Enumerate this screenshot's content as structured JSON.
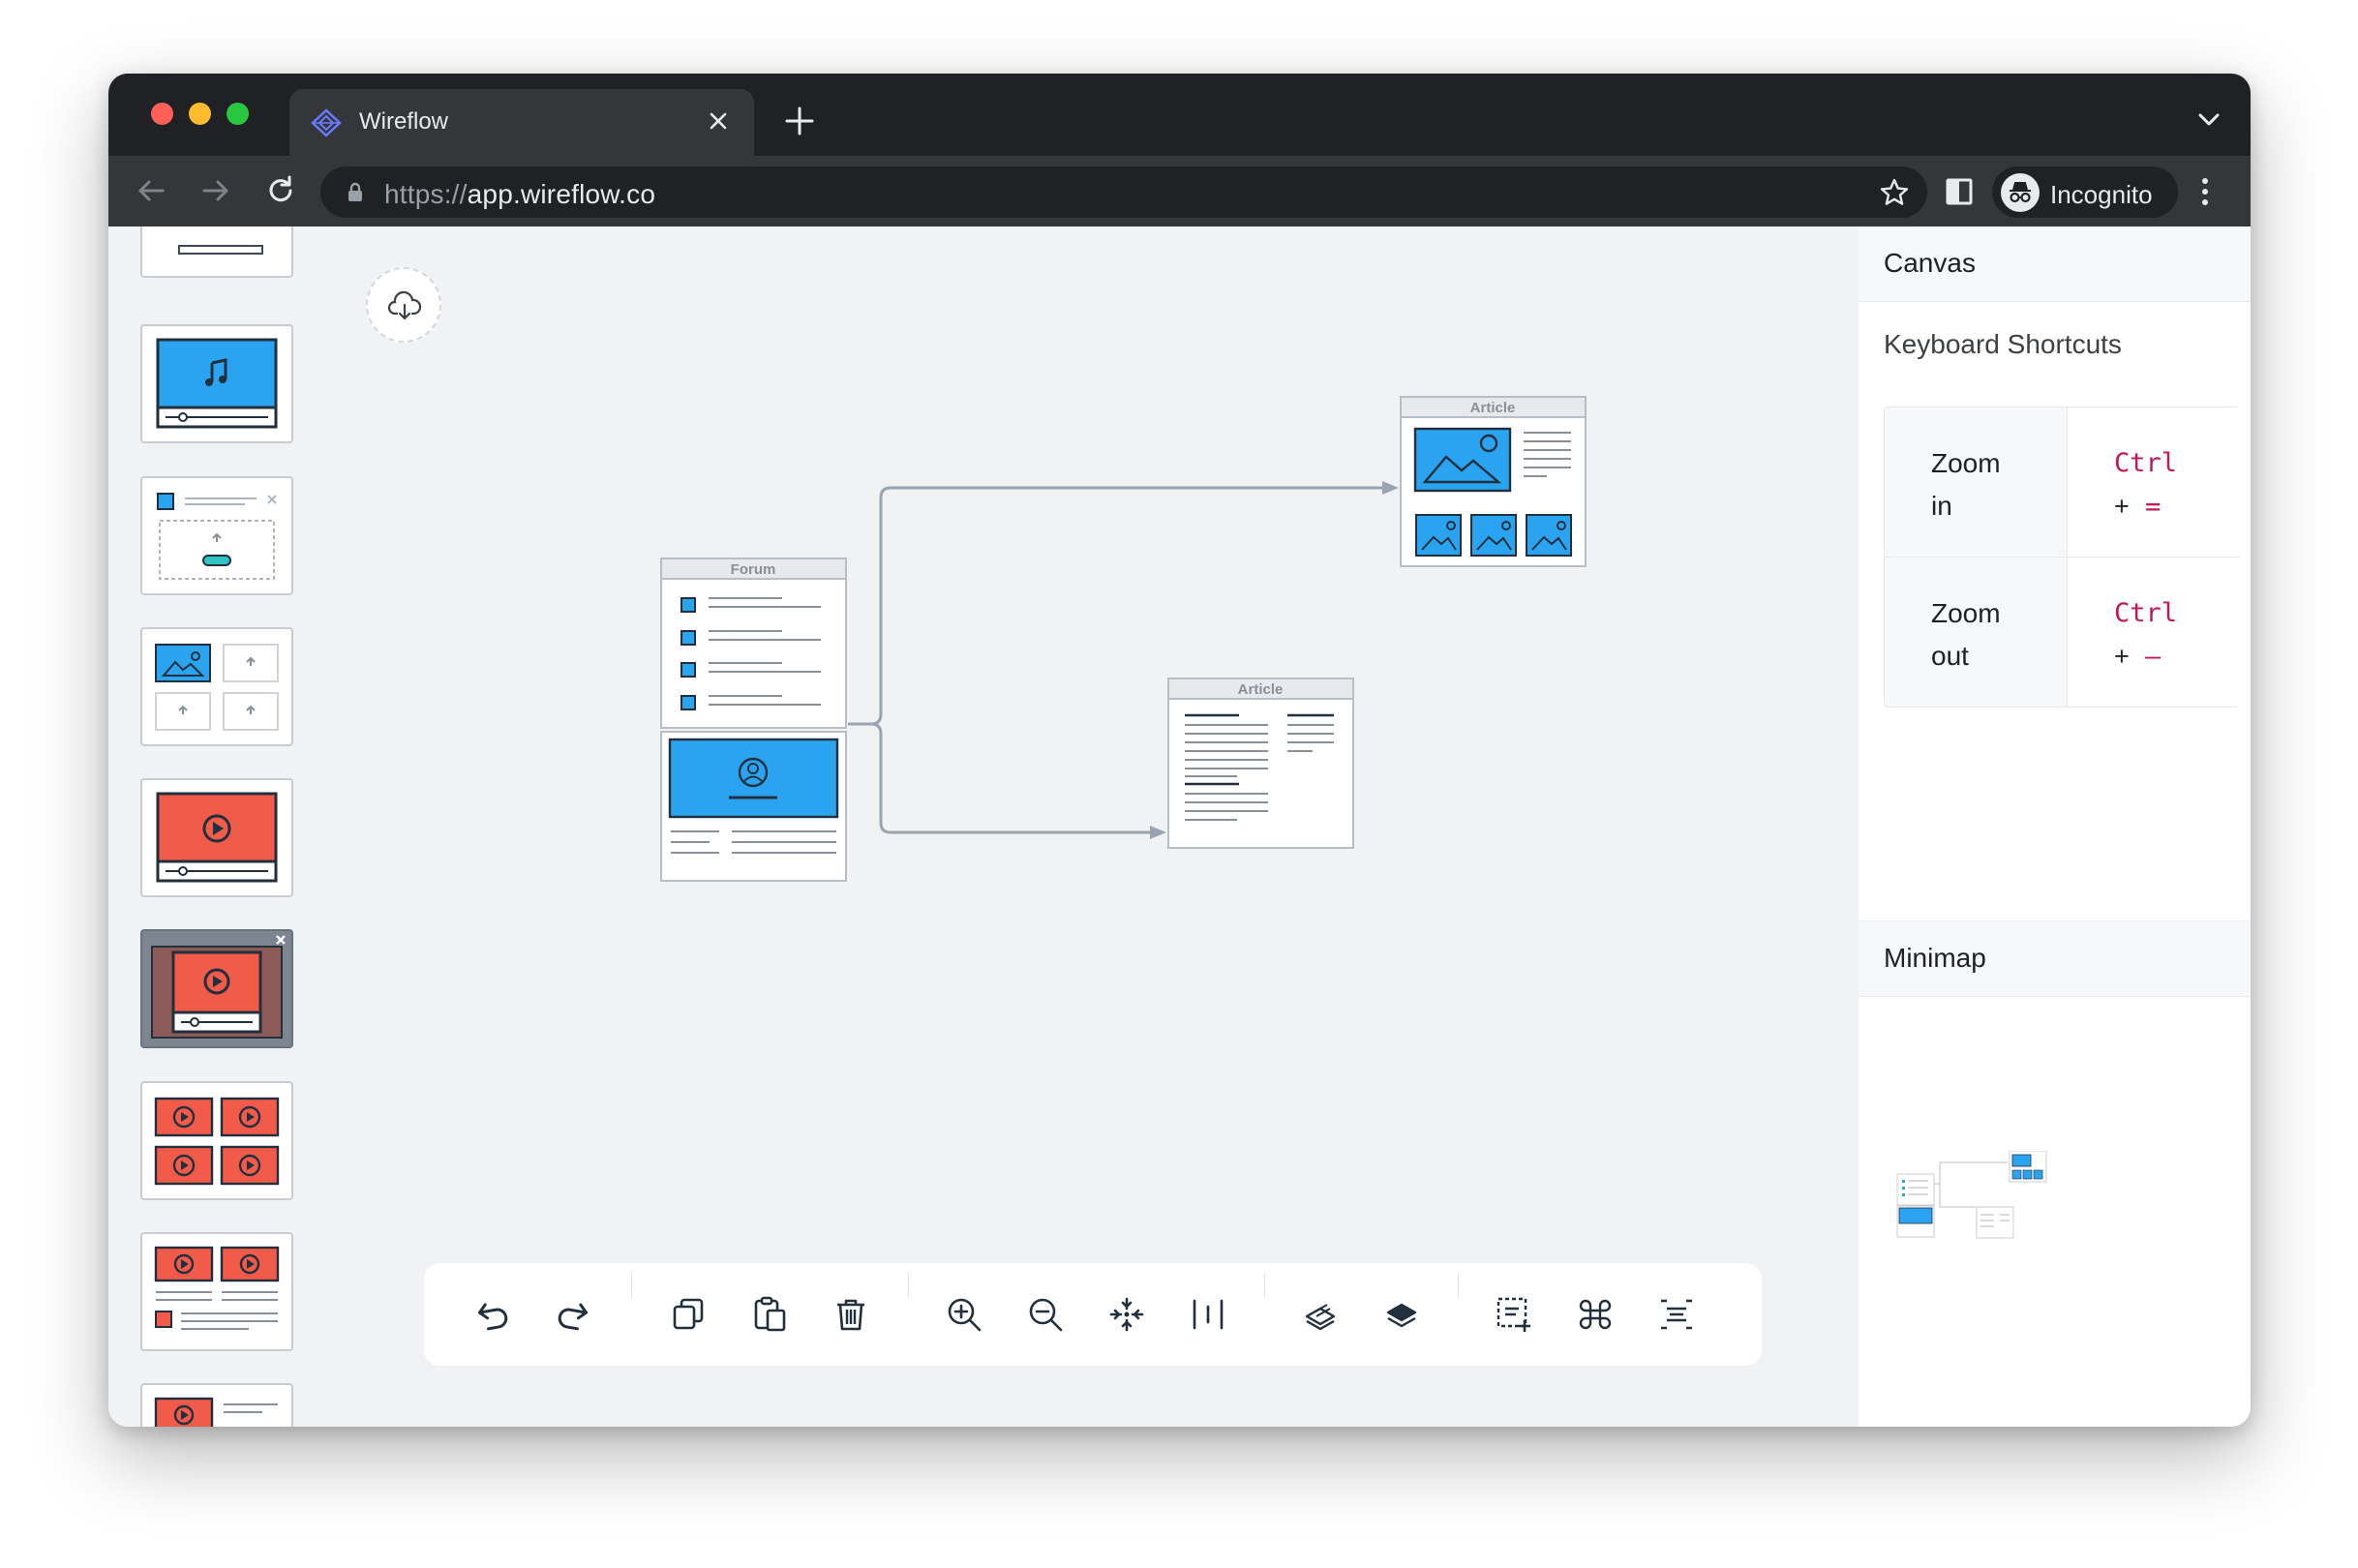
{
  "browser": {
    "tab_title": "Wireflow",
    "url_scheme": "https://",
    "url_host": "app.wireflow.co",
    "profile_label": "Incognito",
    "icons": [
      "back-arrow-icon",
      "forward-arrow-icon",
      "reload-icon",
      "lock-icon",
      "star-icon",
      "side-panel-icon",
      "incognito-icon",
      "kebab-menu-icon"
    ]
  },
  "canvas": {
    "screens": [
      {
        "id": "forum",
        "title": "Forum"
      },
      {
        "id": "article-gallery",
        "title": "Article"
      },
      {
        "id": "article-text",
        "title": "Article"
      }
    ],
    "colors": {
      "accent_blue": "#2aa3f0",
      "accent_red": "#f25a4a",
      "arrow": "#9aa4b0"
    }
  },
  "sidebar": {
    "components": [
      "text-bar",
      "audio-player",
      "file-upload",
      "image-upload-grid",
      "video-player",
      "video-modal",
      "video-grid",
      "video-list",
      "video-item"
    ]
  },
  "toolbar": {
    "tools": [
      "undo",
      "redo",
      "duplicate",
      "paste",
      "delete",
      "zoom-in",
      "zoom-out",
      "fit-to-screen",
      "distribute",
      "bring-forward",
      "send-backward",
      "select-area",
      "shortcuts",
      "align"
    ]
  },
  "right_panel": {
    "title": "Canvas",
    "subtitle": "Keyboard Shortcuts",
    "shortcuts": [
      {
        "action_line1": "Zoom",
        "action_line2": "in",
        "keys_line1": "Ctrl",
        "keys_plus": "+",
        "keys_key": "="
      },
      {
        "action_line1": "Zoom",
        "action_line2": "out",
        "keys_line1": "Ctrl",
        "keys_plus": "+",
        "keys_key": "–"
      }
    ],
    "minimap_title": "Minimap"
  }
}
